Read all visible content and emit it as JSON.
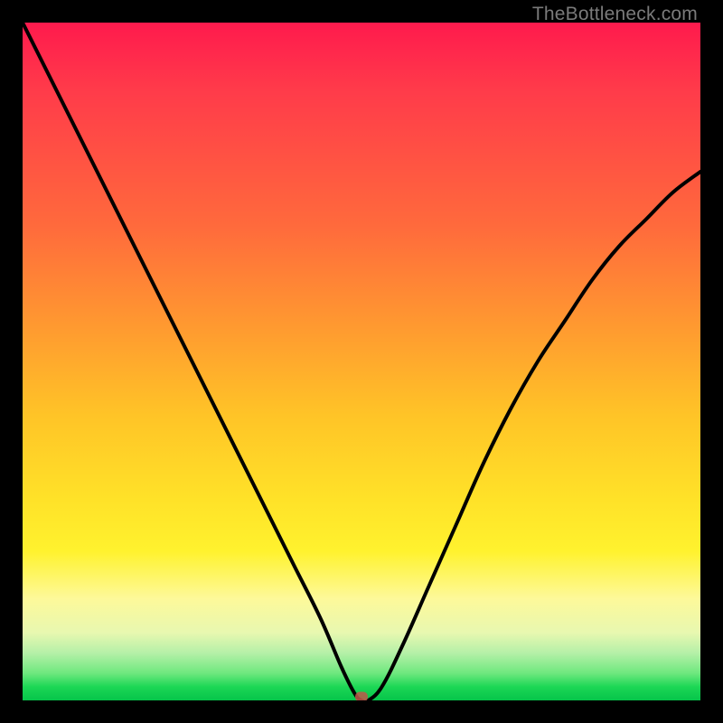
{
  "watermark": "TheBottleneck.com",
  "colors": {
    "curve": "#000000",
    "marker": "#c0574a",
    "frame": "#000000"
  },
  "chart_data": {
    "type": "line",
    "title": "",
    "xlabel": "",
    "ylabel": "",
    "xlim": [
      0,
      100
    ],
    "ylim": [
      0,
      100
    ],
    "series": [
      {
        "name": "bottleneck-curve",
        "x": [
          0,
          4,
          8,
          12,
          16,
          20,
          24,
          28,
          32,
          36,
          40,
          44,
          47,
          49,
          50,
          51,
          53,
          56,
          60,
          64,
          68,
          72,
          76,
          80,
          84,
          88,
          92,
          96,
          100
        ],
        "y": [
          100,
          92,
          84,
          76,
          68,
          60,
          52,
          44,
          36,
          28,
          20,
          12,
          5,
          1,
          0,
          0,
          2,
          8,
          17,
          26,
          35,
          43,
          50,
          56,
          62,
          67,
          71,
          75,
          78
        ]
      }
    ],
    "annotations": [
      {
        "name": "optimal-point",
        "x": 50,
        "y": 0
      }
    ],
    "background_gradient": [
      {
        "pos": 0.0,
        "color": "#ff1a4d"
      },
      {
        "pos": 0.3,
        "color": "#ff6a3c"
      },
      {
        "pos": 0.58,
        "color": "#ffc427"
      },
      {
        "pos": 0.78,
        "color": "#fff22e"
      },
      {
        "pos": 0.93,
        "color": "#b5f0a8"
      },
      {
        "pos": 1.0,
        "color": "#06c44a"
      }
    ]
  }
}
